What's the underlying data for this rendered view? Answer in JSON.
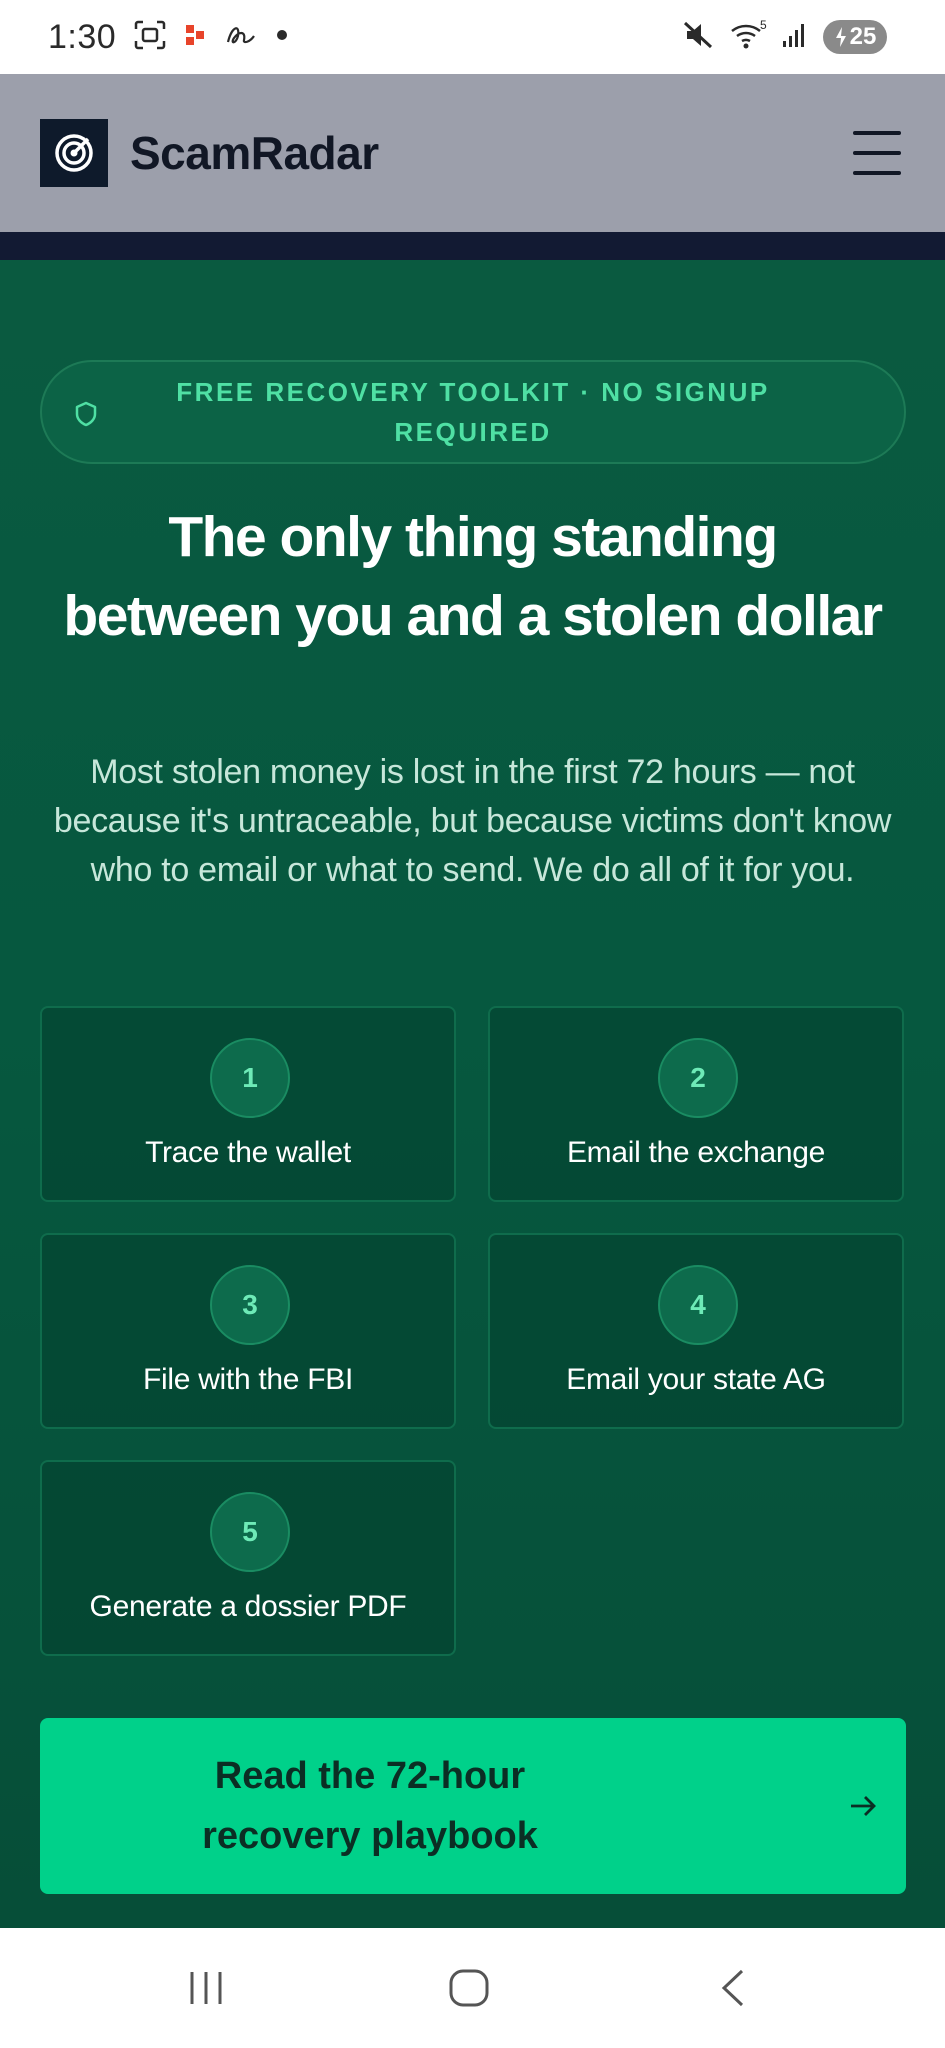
{
  "status_bar": {
    "time": "1:30",
    "battery": "25",
    "icons": [
      "screenshot-icon",
      "app-notification-icon",
      "signature-icon",
      "dot-icon",
      "mute-icon",
      "wifi-icon",
      "signal-icon",
      "battery-icon"
    ]
  },
  "header": {
    "brand": "ScamRadar",
    "logo_icon": "radar-icon",
    "menu_icon": "hamburger-menu-icon"
  },
  "hero": {
    "pill_text": "FREE RECOVERY TOOLKIT · NO SIGNUP REQUIRED",
    "pill_icon": "shield-icon",
    "title": "The only thing standing between you and a stolen dollar",
    "subtitle": "Most stolen money is lost in the first 72 hours — not because it's untraceable, but because victims don't know who to email or what to send. We do all of it for you.",
    "steps": [
      {
        "num": "1",
        "label": "Trace the wallet"
      },
      {
        "num": "2",
        "label": "Email the exchange"
      },
      {
        "num": "3",
        "label": "File with the FBI"
      },
      {
        "num": "4",
        "label": "Email your state AG"
      },
      {
        "num": "5",
        "label": "Generate a dossier PDF"
      }
    ],
    "cta_label": "Read the 72-hour recovery playbook",
    "cta_icon": "arrow-right-icon"
  },
  "colors": {
    "hero_bg": "#06583f",
    "accent": "#00d18a",
    "pill_text": "#4fe0a4",
    "header_bg": "#9c9fab"
  },
  "nav_bar": {
    "icons": [
      "recent-apps-icon",
      "home-icon",
      "back-icon"
    ]
  }
}
